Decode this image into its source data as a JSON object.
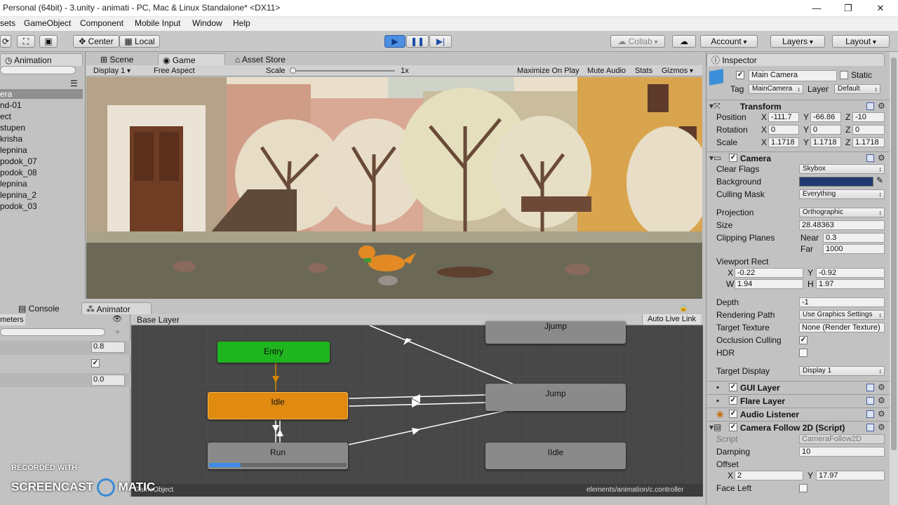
{
  "window": {
    "title": "Personal (64bit) - 3.unity - animati - PC, Mac & Linux Standalone* <DX11>",
    "minimize": "—",
    "maximize": "❐",
    "close": "✕"
  },
  "menu": [
    "sets",
    "GameObject",
    "Component",
    "Mobile Input",
    "Window",
    "Help"
  ],
  "toolbar": {
    "center": "Center",
    "local": "Local",
    "collab": "Collab",
    "account": "Account",
    "layers": "Layers",
    "layout": "Layout"
  },
  "tabs": {
    "animation": "Animation",
    "scene": "Scene",
    "game": "Game",
    "asset_store": "Asset Store",
    "console": "Console",
    "animator": "Animator",
    "inspector": "Inspector"
  },
  "game_bar": {
    "display": "Display 1",
    "aspect": "Free Aspect",
    "scale_label": "Scale",
    "scale_value": "1x",
    "maximize": "Maximize On Play",
    "mute": "Mute Audio",
    "stats": "Stats",
    "gizmos": "Gizmos"
  },
  "hierarchy": [
    "era",
    "nd-01",
    "ect",
    "stupen",
    "krisha",
    "lepnina",
    "podok_07",
    "podok_08",
    "lepnina",
    "lepnina_2",
    "podok_03"
  ],
  "animator": {
    "params_label": "meters",
    "base_layer": "Base Layer",
    "auto_live": "Auto Live Link",
    "param_values": [
      "0.8",
      "0.0"
    ],
    "nodes": {
      "entry": "Entry",
      "idle": "Idle",
      "run": "Run",
      "jump": "Jump",
      "jjump": "Jjump",
      "iidle": "IIdle"
    },
    "run_progress": 0.23,
    "footer_left": "GameObject",
    "footer_path": "elements/animation/c.controller"
  },
  "watermark": {
    "line1": "RECORDED WITH",
    "line2a": "SCREENCAST",
    "line2b": "MATIC"
  },
  "inspector": {
    "name": "Main Camera",
    "static": "Static",
    "tag_label": "Tag",
    "tag": "MainCamera",
    "layer_label": "Layer",
    "layer": "Default",
    "transform": {
      "title": "Transform",
      "position_label": "Position",
      "rotation_label": "Rotation",
      "scale_label": "Scale",
      "pos": [
        "-111.7",
        "-66.86",
        "-10"
      ],
      "rot": [
        "0",
        "0",
        "0"
      ],
      "scale": [
        "1.1718",
        "1.1718",
        "1.1718"
      ]
    },
    "camera": {
      "title": "Camera",
      "clear_flags_label": "Clear Flags",
      "clear_flags": "Skybox",
      "background_label": "Background",
      "background_color": "#1f3a6e",
      "culling_label": "Culling Mask",
      "culling": "Everything",
      "projection_label": "Projection",
      "projection": "Orthographic",
      "size_label": "Size",
      "size": "28.48363",
      "clipping_label": "Clipping Planes",
      "near_label": "Near",
      "near": "0.3",
      "far_label": "Far",
      "far": "1000",
      "viewport_label": "Viewport Rect",
      "vx": "-0.22",
      "vy": "-0.92",
      "vw": "1.94",
      "vh": "1.97",
      "depth_label": "Depth",
      "depth": "-1",
      "rendering_label": "Rendering Path",
      "rendering": "Use Graphics Settings",
      "target_tex_label": "Target Texture",
      "target_tex": "None (Render Texture)",
      "occlusion_label": "Occlusion Culling",
      "hdr_label": "HDR",
      "target_display_label": "Target Display",
      "target_display": "Display 1"
    },
    "components": {
      "gui": "GUI Layer",
      "flare": "Flare Layer",
      "audio": "Audio Listener",
      "follow": "Camera Follow 2D (Script)"
    },
    "follow": {
      "script_label": "Script",
      "script": "CameraFollow2D",
      "damping_label": "Damping",
      "damping": "10",
      "offset_label": "Offset",
      "ox": "2",
      "oy": "17.97",
      "face_left_label": "Face Left"
    },
    "axes": {
      "x": "X",
      "y": "Y",
      "z": "Z",
      "w": "W",
      "h": "H"
    }
  }
}
